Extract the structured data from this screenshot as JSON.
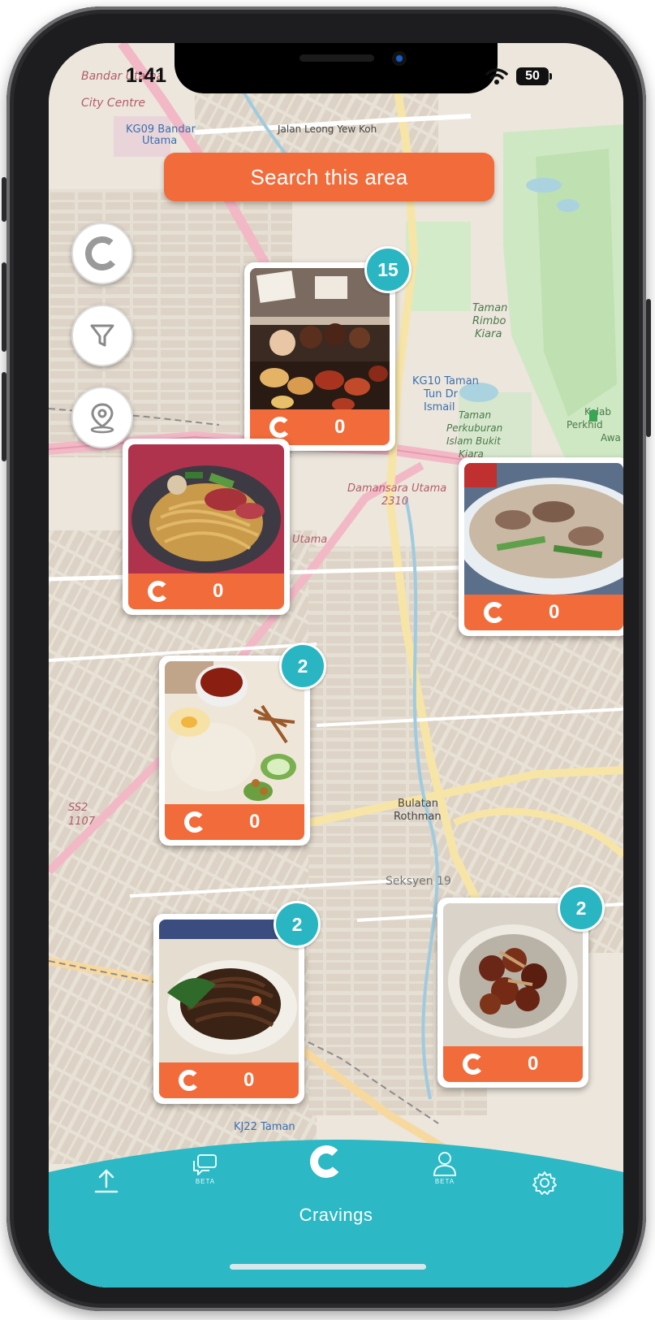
{
  "status_bar": {
    "time": "1:41",
    "battery": "50"
  },
  "search_area_button": {
    "label": "Search this area"
  },
  "map_labels": {
    "bandar_utama": "Bandar Utama City Centre",
    "kg09": "KG09 Bandar Utama",
    "leong_yew_koh": "Jalan Leong Yew Koh",
    "taman_rimbo": "Taman Rimbo Kiara",
    "kg10": "KG10 Taman Tun Dr Ismail",
    "perkuburan": "Taman Perkuburan Islam Bukit Kiara",
    "damansara_utama": "Damansara Utama 2310",
    "bulatan": "Bulatan Rothman",
    "seksyen19": "Seksyen 19",
    "kj22": "KJ22 Taman",
    "kelab": "Kelab Perkhid Awa",
    "utama": "Utama",
    "ss2": "SS2 1107"
  },
  "map_markers": [
    {
      "id": "desserts",
      "cravings": "0",
      "cluster": "15"
    },
    {
      "id": "noodles",
      "cravings": "0",
      "cluster": ""
    },
    {
      "id": "soup",
      "cravings": "0",
      "cluster": ""
    },
    {
      "id": "nasi-lemak",
      "cravings": "0",
      "cluster": "2"
    },
    {
      "id": "hokkien-mee",
      "cravings": "0",
      "cluster": "2"
    },
    {
      "id": "fried-chicken",
      "cravings": "0",
      "cluster": "2"
    }
  ],
  "side_controls": [
    "cravings-logo",
    "filter",
    "my-location"
  ],
  "tab_bar": {
    "active_label": "Cravings",
    "beta_tag_1": "BETA",
    "beta_tag_2": "BETA",
    "icons": [
      "upload-icon",
      "chat-icon",
      "cravings-logo-icon",
      "profile-icon",
      "settings-icon"
    ]
  },
  "colors": {
    "accent": "#f26b3a",
    "teal": "#29b6c2",
    "map_bg": "#efe9df"
  }
}
